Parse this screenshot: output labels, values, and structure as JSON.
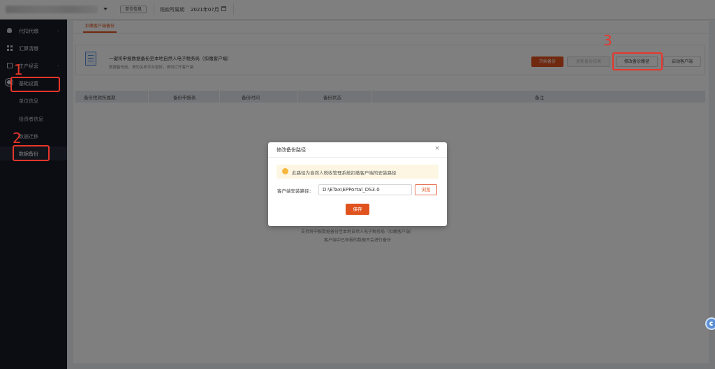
{
  "topbar": {
    "unit_info": "单位信息",
    "period_label": "税款所属期",
    "period_value": "2021年07月"
  },
  "sidebar": {
    "items": [
      {
        "label": "代扣代缴",
        "arrow": "⌄"
      },
      {
        "label": "汇算清缴"
      },
      {
        "label": "生产经营",
        "arrow": "⌄"
      },
      {
        "label": "基础设置"
      }
    ],
    "sub_items": [
      {
        "label": "单位信息"
      },
      {
        "label": "投资者信息"
      },
      {
        "label": "数据迁移"
      },
      {
        "label": "数据备份"
      }
    ]
  },
  "main": {
    "tab": "扣缴客户端备份",
    "info_title": "一键将申报数据备份至本地自然人电子税务局（扣缴客户端）",
    "info_sub": "数据备份前，请勿关闭平台窗体，请勿打开客户端",
    "buttons": {
      "start": "开始备份",
      "update": "更新备份结果",
      "modify": "修改备份路径",
      "launch": "启动客户端"
    },
    "table_headers": [
      "备份税款所属期",
      "备份申报表",
      "备份时间",
      "备份状态",
      "备注"
    ],
    "empty_line1": "支持将申报数据备份至本地自然人电子税务局（扣缴客户端）",
    "empty_line2": "客户端中已申报的数据不会进行备份"
  },
  "annotations": {
    "n1": "1",
    "n2": "2",
    "n3": "3"
  },
  "dialog": {
    "title": "修改备份路径",
    "close": "×",
    "notice": "此路径为自然人税收管理系统扣缴客户端的安装路径",
    "path_label": "客户端安装路径：",
    "path_value": "D:\\ETax\\EPPortal_DS3.0",
    "browse": "浏览",
    "save": "保存"
  },
  "colors": {
    "accent": "#e0531f",
    "annotation": "#e8362a",
    "sidebar_bg": "#171b26"
  },
  "icons": [
    "person-icon",
    "grid-icon",
    "lock-icon",
    "gear-icon",
    "calendar-icon",
    "document-icon",
    "info-icon",
    "help-icon"
  ]
}
